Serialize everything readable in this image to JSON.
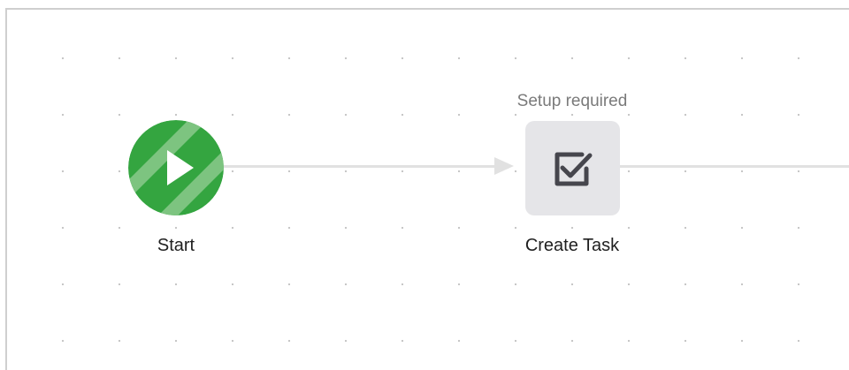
{
  "workflow": {
    "start": {
      "label": "Start",
      "icon": "play-icon"
    },
    "task": {
      "label": "Create Task",
      "status": "Setup required",
      "icon": "checkbox-icon"
    }
  },
  "colors": {
    "start_green": "#34a540",
    "start_stripe": "#7dc480",
    "connector": "#e1e1e1",
    "task_bg": "#e5e5e8",
    "task_icon": "#46464d"
  }
}
